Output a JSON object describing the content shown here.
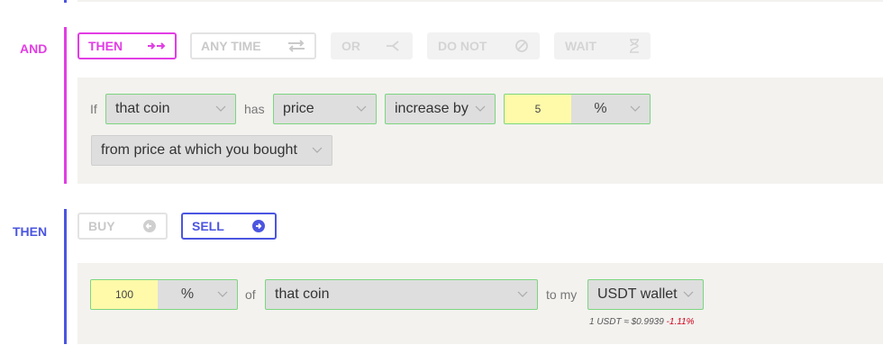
{
  "colors": {
    "and_accent": "#e23de5",
    "then_accent": "#4b55e0",
    "field_border": "#7cd67f",
    "panel_bg": "#f3f2ef",
    "number_bg": "#fffaaa",
    "negative": "#d0021b"
  },
  "and_section": {
    "label": "AND",
    "tabs": [
      {
        "label": "THEN",
        "icon": "double-arrow-right-icon",
        "state": "active"
      },
      {
        "label": "ANY TIME",
        "icon": "swap-arrows-icon",
        "state": "inactive"
      },
      {
        "label": "OR",
        "icon": "branch-icon",
        "state": "disabled"
      },
      {
        "label": "DO NOT",
        "icon": "prohibited-icon",
        "state": "disabled"
      },
      {
        "label": "WAIT",
        "icon": "hourglass-icon",
        "state": "disabled"
      }
    ],
    "condition": {
      "if_text": "If",
      "subject": "that coin",
      "has_text": "has",
      "metric": "price",
      "direction": "increase by",
      "amount": "5",
      "unit": "%",
      "reference": "from price at which you bought"
    }
  },
  "then_section": {
    "label": "THEN",
    "actions": [
      {
        "label": "BUY",
        "icon": "circle-arrow-left-icon",
        "state": "inactive"
      },
      {
        "label": "SELL",
        "icon": "circle-arrow-right-icon",
        "state": "active"
      }
    ],
    "order": {
      "amount": "100",
      "unit": "%",
      "of_text": "of",
      "asset": "that coin",
      "to_text": "to my",
      "wallet": "USDT wallet",
      "rate_text": "1 USDT ≈ $0.9939",
      "rate_change": "-1.11%"
    }
  }
}
